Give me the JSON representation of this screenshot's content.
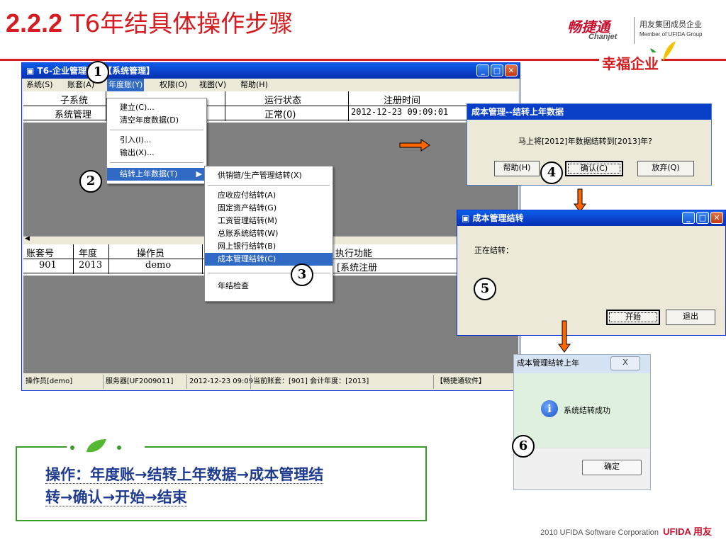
{
  "slide": {
    "title_num": "2.2.2",
    "title_text": "T6年结具体操作步骤",
    "brand_cn": "畅捷通",
    "brand_en": "Chanjet",
    "member_cn": "用友集团成员企业",
    "member_en": "Member of UFIDA Group",
    "slogan": "幸福企业",
    "summary_line1": "操作：年度账→结转上年数据→成本管理结",
    "summary_line2": "转→确认→开始→结束",
    "footer": "2010 UFIDA Software Corporation",
    "footer_brand": "UFIDA 用友"
  },
  "main_window": {
    "title": "T6-企业管理软件【系统管理】",
    "menu": [
      "系统(S)",
      "账套(A)",
      "年度账(Y)",
      "权限(O)",
      "视图(V)",
      "帮助(H)"
    ],
    "top_headers": [
      "子系统",
      "运行状态",
      "注册时间"
    ],
    "top_row": [
      "系统管理",
      "正常(0)",
      "2012-12-23 09:09:01"
    ],
    "bottom_headers": [
      "账套号",
      "年度",
      "操作员",
      "执行功能"
    ],
    "bottom_row": [
      "901",
      "2013",
      "demo",
      "[系统注册"
    ],
    "status": [
      "操作员[demo]",
      "服务器[UF2009011]",
      "2012-12-23 09:09",
      "当前账套：[901] 会计年度：[2013]",
      "【畅捷通软件】"
    ]
  },
  "year_menu": {
    "items": [
      "建立(C)...",
      "清空年度数据(D)",
      "引入(I)...",
      "输出(X)...",
      "结转上年数据(T)"
    ]
  },
  "carry_menu": {
    "items": [
      "供销链/生产管理结转(X)",
      "应收应付结转(A)",
      "固定资产结转(G)",
      "工资管理结转(M)",
      "总账系统结转(W)",
      "网上银行结转(B)",
      "成本管理结转(C)",
      "年结检查"
    ]
  },
  "confirm_dialog": {
    "title": "成本管理--结转上年数据",
    "message": "马上将[2012]年数据结转到[2013]年?",
    "help": "帮助(H)",
    "ok": "确认(C)",
    "cancel": "放弃(Q)"
  },
  "carry_dialog": {
    "title": "成本管理结转",
    "label": "正在结转：",
    "start": "开始",
    "exit": "退出"
  },
  "success_dialog": {
    "title": "成本管理结转上年",
    "message": "系统结转成功",
    "ok": "确定",
    "close": "X"
  },
  "steps": [
    "1",
    "2",
    "3",
    "4",
    "5",
    "6"
  ],
  "colors": {
    "accent": "#d51c21",
    "xp_title": "#0a3fc8",
    "highlight": "#316ac5",
    "summary_border": "#3a9a2a",
    "summary_text": "#1f3b8f"
  }
}
